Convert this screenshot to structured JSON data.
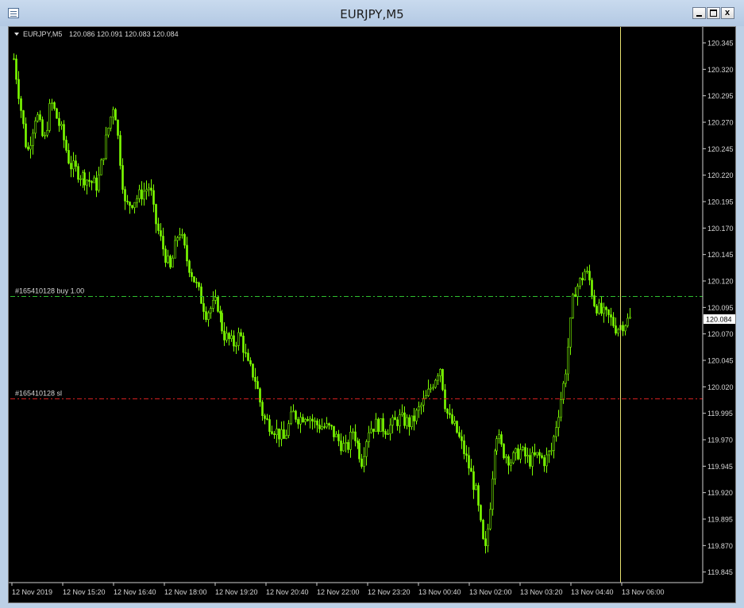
{
  "window": {
    "title": "EURJPY,M5"
  },
  "chart_data": {
    "type": "candlestick",
    "title": "EURJPY,M5",
    "ohlc_readout": "120.086 120.091 120.083 120.084",
    "current_price": "120.084",
    "ylim": [
      119.835,
      120.36
    ],
    "y_ticks": [
      "120.345",
      "120.320",
      "120.295",
      "120.270",
      "120.245",
      "120.220",
      "120.195",
      "120.170",
      "120.145",
      "120.120",
      "120.095",
      "120.070",
      "120.045",
      "120.020",
      "119.995",
      "119.970",
      "119.945",
      "119.920",
      "119.895",
      "119.870",
      "119.845"
    ],
    "x_ticks": [
      "12 Nov 2019",
      "12 Nov 15:20",
      "12 Nov 16:40",
      "12 Nov 18:00",
      "12 Nov 19:20",
      "12 Nov 20:40",
      "12 Nov 22:00",
      "12 Nov 23:20",
      "13 Nov 00:40",
      "13 Nov 02:00",
      "13 Nov 03:20",
      "13 Nov 04:40",
      "13 Nov 06:00"
    ],
    "levels": [
      {
        "label": "#165410128 buy 1.00",
        "price": 120.106,
        "color": "#2fbf2f"
      },
      {
        "label": "#165410128 sl",
        "price": 120.009,
        "color": "#d42020"
      }
    ],
    "cursor_line": {
      "color": "#e8e070"
    },
    "candle_color": "#7cfc00",
    "close_path": [
      [
        0,
        120.33
      ],
      [
        1.2,
        120.24
      ],
      [
        2,
        120.28
      ],
      [
        2.7,
        120.25
      ],
      [
        3.3,
        120.29
      ],
      [
        4.3,
        120.26
      ],
      [
        5,
        120.23
      ],
      [
        6,
        120.22
      ],
      [
        7.5,
        120.21
      ],
      [
        8.4,
        120.26
      ],
      [
        9,
        120.29
      ],
      [
        10,
        120.19
      ],
      [
        11.2,
        120.2
      ],
      [
        12.2,
        120.21
      ],
      [
        12.6,
        120.18
      ],
      [
        13.4,
        120.15
      ],
      [
        14,
        120.13
      ],
      [
        14.8,
        120.17
      ],
      [
        15.5,
        120.14
      ],
      [
        17.2,
        120.09
      ],
      [
        18.2,
        120.1
      ],
      [
        18.8,
        120.07
      ],
      [
        19.7,
        120.06
      ],
      [
        20.3,
        120.07
      ],
      [
        21,
        120.04
      ],
      [
        21.6,
        120.03
      ],
      [
        22.4,
        119.99
      ],
      [
        23.4,
        119.98
      ],
      [
        24.2,
        119.97
      ],
      [
        25,
        119.995
      ],
      [
        25.6,
        119.99
      ],
      [
        26.2,
        119.995
      ],
      [
        27,
        119.985
      ],
      [
        28.4,
        119.98
      ],
      [
        29,
        119.97
      ],
      [
        29.8,
        119.96
      ],
      [
        30.4,
        119.98
      ],
      [
        31.2,
        119.95
      ],
      [
        31.8,
        119.98
      ],
      [
        32.6,
        119.985
      ],
      [
        33.4,
        119.98
      ],
      [
        34.6,
        119.99
      ],
      [
        35.6,
        119.985
      ],
      [
        36.4,
        120.0
      ],
      [
        37,
        120.01
      ],
      [
        37.8,
        120.03
      ],
      [
        38.2,
        120.04
      ],
      [
        38.7,
        120.0
      ],
      [
        39,
        119.99
      ],
      [
        39.6,
        119.98
      ],
      [
        40.3,
        119.96
      ],
      [
        40.9,
        119.94
      ],
      [
        41.4,
        119.92
      ],
      [
        41.8,
        119.89
      ],
      [
        42.2,
        119.86
      ],
      [
        42.6,
        119.9
      ],
      [
        43.2,
        119.98
      ],
      [
        43.8,
        119.96
      ],
      [
        44.6,
        119.95
      ],
      [
        45.4,
        119.96
      ],
      [
        46.2,
        119.95
      ],
      [
        47,
        119.955
      ],
      [
        47.6,
        119.95
      ],
      [
        48.2,
        119.96
      ],
      [
        48.8,
        119.995
      ],
      [
        49.4,
        120.03
      ],
      [
        49.8,
        120.07
      ],
      [
        50.2,
        120.11
      ],
      [
        50.8,
        120.12
      ],
      [
        51.2,
        120.13
      ],
      [
        51.6,
        120.12
      ],
      [
        52,
        120.1
      ],
      [
        52.6,
        120.09
      ],
      [
        53.4,
        120.085
      ],
      [
        54,
        120.075
      ],
      [
        54.6,
        120.08
      ],
      [
        55.2,
        120.084
      ]
    ],
    "cursor_x": 54.4,
    "x_total": 60.5
  }
}
